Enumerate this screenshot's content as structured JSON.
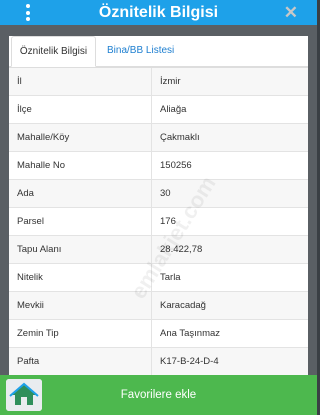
{
  "header": {
    "title": "Öznitelik Bilgisi",
    "menu_icon": "more-vertical-icon",
    "close_icon": "close-icon",
    "accent_color": "#1ea1e9"
  },
  "tabs": [
    {
      "label": "Öznitelik Bilgisi",
      "active": true
    },
    {
      "label": "Bina/BB Listesi",
      "active": false
    }
  ],
  "rows": [
    {
      "key": "İl",
      "value": "İzmir"
    },
    {
      "key": "İlçe",
      "value": "Aliağa"
    },
    {
      "key": "Mahalle/Köy",
      "value": "Çakmaklı"
    },
    {
      "key": "Mahalle No",
      "value": "150256"
    },
    {
      "key": "Ada",
      "value": "30"
    },
    {
      "key": "Parsel",
      "value": "176"
    },
    {
      "key": "Tapu Alanı",
      "value": "28.422,78"
    },
    {
      "key": "Nitelik",
      "value": "Tarla"
    },
    {
      "key": "Mevkii",
      "value": "Karacadağ"
    },
    {
      "key": "Zemin Tip",
      "value": "Ana Taşınmaz"
    },
    {
      "key": "Pafta",
      "value": "K17-B-24-D-4"
    }
  ],
  "watermark": "emlakjet.com",
  "favorite_button": {
    "label": "Favorilere ekle",
    "color": "#4db84e"
  },
  "logo_icon": "home-logo-icon"
}
